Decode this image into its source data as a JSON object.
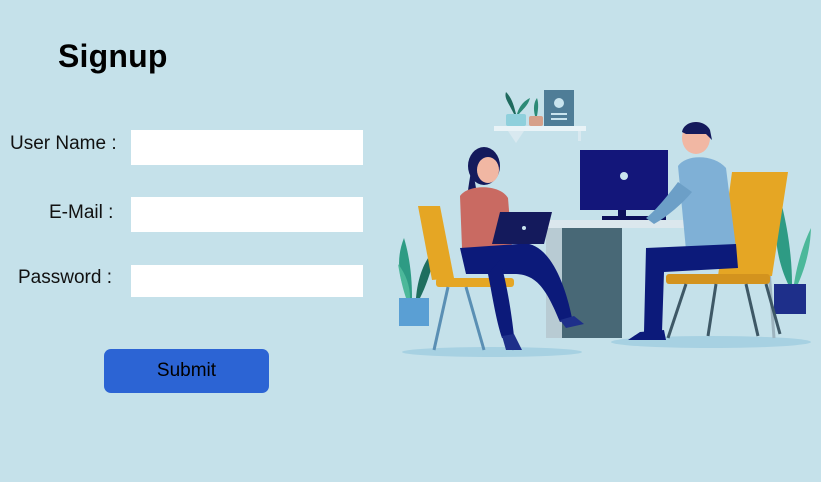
{
  "signup": {
    "title": "Signup",
    "fields": {
      "username": {
        "label": "User Name :",
        "value": "",
        "placeholder": ""
      },
      "email": {
        "label": "E-Mail :",
        "value": "",
        "placeholder": ""
      },
      "password": {
        "label": "Password :",
        "value": "",
        "placeholder": ""
      }
    },
    "submit_label": "Submit"
  },
  "illustration": {
    "icon": "office-workers-illustration"
  },
  "colors": {
    "background": "#c5e1ea",
    "button": "#2c64d4",
    "input_bg": "#ffffff"
  }
}
